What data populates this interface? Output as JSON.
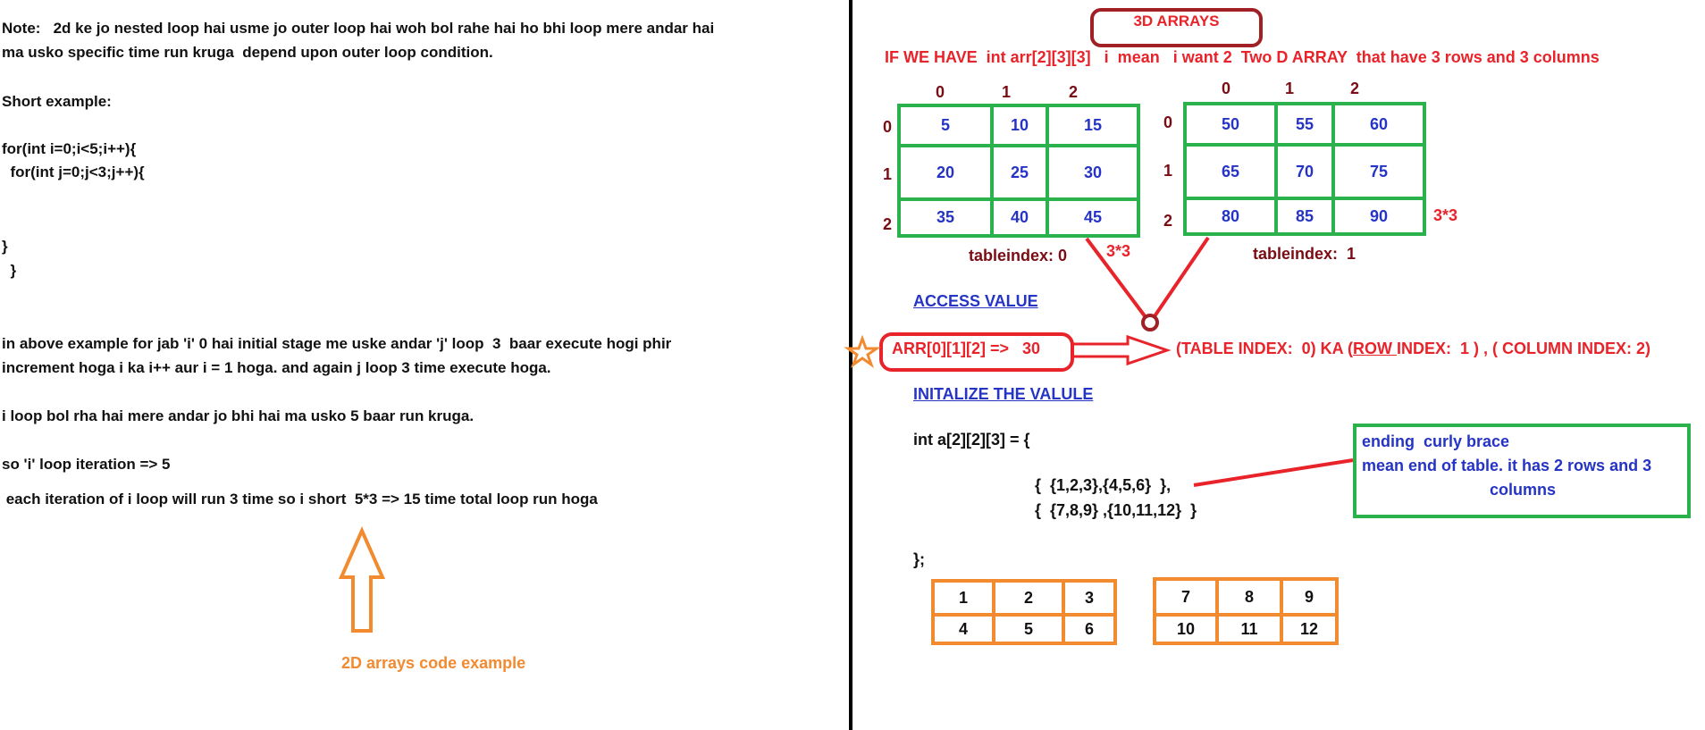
{
  "left": {
    "note_line1": "Note:   2d ke jo nested loop hai usme jo outer loop hai woh bol rahe hai ho bhi loop mere andar hai",
    "note_line2": "ma usko specific time run kruga  depend upon outer loop condition.",
    "short_example": "Short example:",
    "code1": "for(int i=0;i<5;i++){",
    "code2": "  for(int j=0;j<3;j++){",
    "code3": "}",
    "code4": "  }",
    "explain1": "in above example for jab 'i' 0 hai initial stage me uske andar 'j' loop  3  baar execute hogi phir",
    "explain2": "increment hoga i ka i++ aur i = 1 hoga. and again j loop 3 time execute hoga.",
    "explain3": "i loop bol rha hai mere andar jo bhi hai ma usko 5 baar run kruga.",
    "explain4": "so 'i' loop iteration => 5",
    "explain5": " each iteration of i loop will run 3 time so i short  5*3 => 15 time total loop run hoga",
    "caption": "2D arrays code example"
  },
  "right": {
    "title": "3D ARRAYS",
    "subtitle": "IF WE HAVE  int arr[2][3][3]   i  mean   i want 2  Two D ARRAY  that have 3 rows and 3 columns",
    "table0": {
      "col_headers": [
        "0",
        "1",
        "2"
      ],
      "row_headers": [
        "0",
        "1",
        "2"
      ],
      "rows": [
        [
          "5",
          "10",
          "15"
        ],
        [
          "20",
          "25",
          "30"
        ],
        [
          "35",
          "40",
          "45"
        ]
      ],
      "label": "tableindex: 0",
      "dim": "3*3"
    },
    "table1": {
      "col_headers": [
        "0",
        "1",
        "2"
      ],
      "row_headers": [
        "0",
        "1",
        "2"
      ],
      "rows": [
        [
          "50",
          "55",
          "60"
        ],
        [
          "65",
          "70",
          "75"
        ],
        [
          "80",
          "85",
          "90"
        ]
      ],
      "label": "tableindex:  1",
      "dim": "3*3"
    },
    "access_heading": "ACCESS VALUE",
    "access_expr": "ARR[0][1][2] =>   30",
    "access_explain_a": "(TABLE INDEX:  0) KA (",
    "access_explain_row": "ROW ",
    "access_explain_b": "INDEX:  1 ) , ( COLUMN INDEX: 2)",
    "init_heading": "INITALIZE THE VALULE",
    "init_code1": "int a[2][2][3] = {",
    "init_code2": "{  {1,2,3},{4,5,6}  },",
    "init_code3": "{  {7,8,9} ,{10,11,12}  }",
    "init_code4": "};",
    "note_line1": "ending  curly brace",
    "note_line2": "mean end of table. it has 2 rows and 3",
    "note_line3": "columns",
    "otable0": [
      [
        "1",
        "2",
        "3"
      ],
      [
        "4",
        "5",
        "6"
      ]
    ],
    "otable1": [
      [
        "7",
        "8",
        "9"
      ],
      [
        "10",
        "11",
        "12"
      ]
    ]
  },
  "colors": {
    "green": "#2bb24c",
    "red": "#e8232a",
    "dark_red": "#7a0c14",
    "blue": "#2534c4",
    "orange": "#f28a30"
  }
}
